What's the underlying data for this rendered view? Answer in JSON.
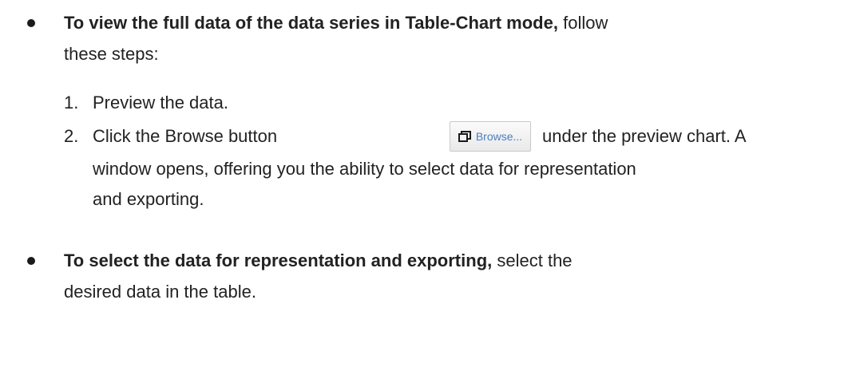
{
  "bullets": [
    {
      "bold": "To view the full data of the data series in Table-Chart mode,",
      "rest": "follow",
      "continuation": "these steps:"
    },
    {
      "bold": "To select the data for representation and exporting,",
      "rest": "select the",
      "continuation": "desired data in the table."
    }
  ],
  "steps": [
    {
      "number": "1.",
      "text": "Preview the data."
    },
    {
      "number": "2.",
      "before_button": "Click the Browse button",
      "after_button": "under the preview chart. A",
      "line2": "window opens, offering you the ability to select data for representation",
      "line3": "and exporting."
    }
  ],
  "browse_button": {
    "label": "Browse...",
    "icon": "window-icon"
  },
  "colors": {
    "text": "#222222",
    "button_label": "#4a7fc1"
  }
}
